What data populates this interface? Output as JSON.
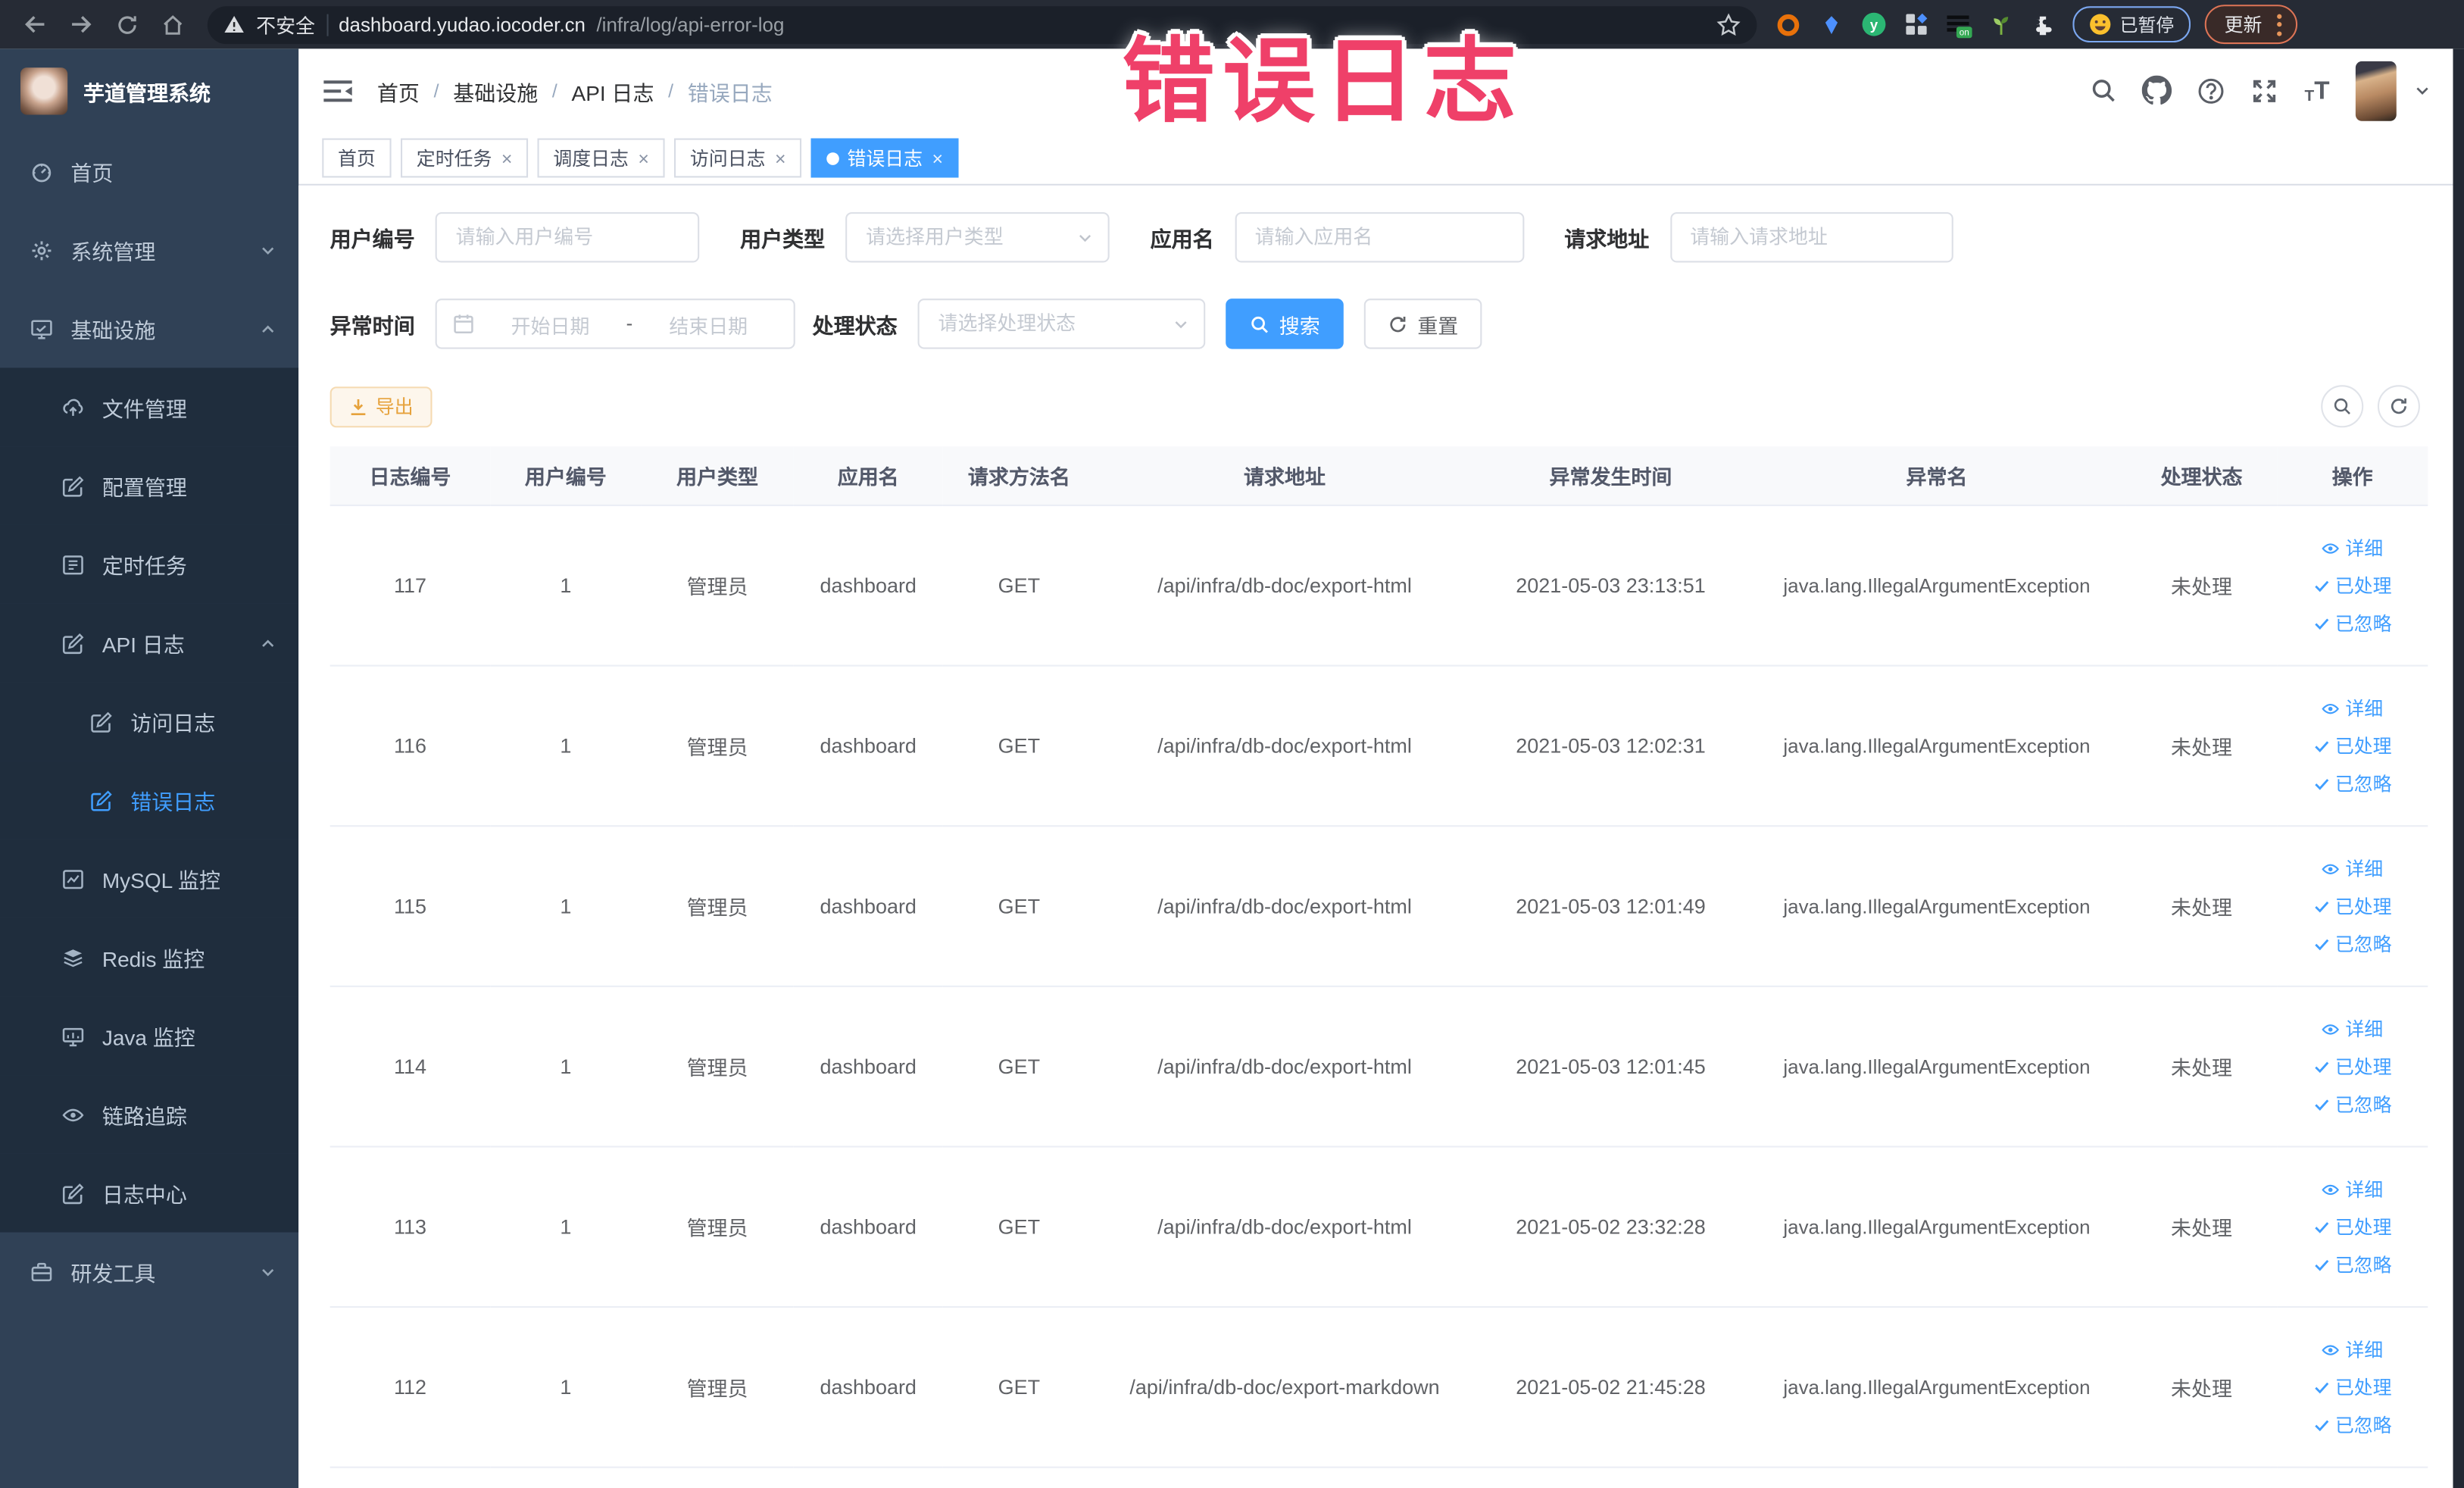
{
  "colors": {
    "primary": "#409eff",
    "warning": "#e6a23c",
    "overlay_pink": "#ef4069",
    "sidebar_bg": "#304156",
    "sidebar_submenu_bg": "#1f2d3d",
    "chrome_bg": "#262b35"
  },
  "overlay": {
    "title": "错误日志"
  },
  "browser": {
    "security_label": "不安全",
    "url_host": "dashboard.yudao.iocoder.cn",
    "url_path": "/infra/log/api-error-log",
    "paused_badge": "已暂停",
    "update_button": "更新",
    "extension_on_badge": "on",
    "extension_y_label": "y"
  },
  "sidebar": {
    "logo_title": "芋道管理系统",
    "items": [
      {
        "key": "home",
        "label": "首页",
        "icon": "dashboard-icon",
        "level": 1
      },
      {
        "key": "system-mgmt",
        "label": "系统管理",
        "icon": "gear-icon",
        "level": 1,
        "chevron": "down"
      },
      {
        "key": "infrastructure",
        "label": "基础设施",
        "icon": "monitor-check-icon",
        "level": 1,
        "chevron": "up"
      },
      {
        "key": "file-mgmt",
        "label": "文件管理",
        "icon": "upload-cloud-icon",
        "level": 2,
        "sub": true
      },
      {
        "key": "config-mgmt",
        "label": "配置管理",
        "icon": "edit-icon",
        "level": 2,
        "sub": true
      },
      {
        "key": "scheduled-jobs",
        "label": "定时任务",
        "icon": "schedule-icon",
        "level": 2,
        "sub": true
      },
      {
        "key": "api-log",
        "label": "API 日志",
        "icon": "log-icon",
        "level": 2,
        "sub": true,
        "chevron": "up"
      },
      {
        "key": "access-log",
        "label": "访问日志",
        "icon": "log-icon",
        "level": 3,
        "sub": true
      },
      {
        "key": "error-log",
        "label": "错误日志",
        "icon": "log-icon",
        "level": 3,
        "sub": true,
        "active": true
      },
      {
        "key": "mysql-monitor",
        "label": "MySQL 监控",
        "icon": "chart-icon",
        "level": 2,
        "sub": true
      },
      {
        "key": "redis-monitor",
        "label": "Redis 监控",
        "icon": "layers-icon",
        "level": 2,
        "sub": true
      },
      {
        "key": "java-monitor",
        "label": "Java 监控",
        "icon": "java-monitor-icon",
        "level": 2,
        "sub": true
      },
      {
        "key": "trace",
        "label": "链路追踪",
        "icon": "eye-icon",
        "level": 2,
        "sub": true
      },
      {
        "key": "log-center",
        "label": "日志中心",
        "icon": "log-center-icon",
        "level": 2,
        "sub": true
      },
      {
        "key": "dev-tools",
        "label": "研发工具",
        "icon": "toolbox-icon",
        "level": 1,
        "chevron": "down"
      }
    ]
  },
  "breadcrumb": [
    "首页",
    "基础设施",
    "API 日志",
    "错误日志"
  ],
  "tabs": [
    {
      "key": "home",
      "label": "首页",
      "closable": false,
      "active": false
    },
    {
      "key": "jobs",
      "label": "定时任务",
      "closable": true,
      "active": false
    },
    {
      "key": "job-log",
      "label": "调度日志",
      "closable": true,
      "active": false
    },
    {
      "key": "access-log",
      "label": "访问日志",
      "closable": true,
      "active": false
    },
    {
      "key": "error-log",
      "label": "错误日志",
      "closable": true,
      "active": true
    }
  ],
  "filters": {
    "user_id_label": "用户编号",
    "user_id_placeholder": "请输入用户编号",
    "user_type_label": "用户类型",
    "user_type_placeholder": "请选择用户类型",
    "app_name_label": "应用名",
    "app_name_placeholder": "请输入应用名",
    "request_url_label": "请求地址",
    "request_url_placeholder": "请输入请求地址",
    "exception_time_label": "异常时间",
    "start_date_placeholder": "开始日期",
    "range_separator": "-",
    "end_date_placeholder": "结束日期",
    "process_status_label": "处理状态",
    "process_status_placeholder": "请选择处理状态",
    "search_button": "搜索",
    "reset_button": "重置"
  },
  "toolbar": {
    "export_button": "导出"
  },
  "table": {
    "columns": [
      "日志编号",
      "用户编号",
      "用户类型",
      "应用名",
      "请求方法名",
      "请求地址",
      "异常发生时间",
      "异常名",
      "处理状态",
      "操作"
    ],
    "actions": [
      "详细",
      "已处理",
      "已忽略"
    ],
    "rows": [
      {
        "id": "117",
        "user_id": "1",
        "user_type": "管理员",
        "app": "dashboard",
        "method": "GET",
        "url": "/api/infra/db-doc/export-html",
        "time": "2021-05-03 23:13:51",
        "exception": "java.lang.IllegalArgumentException",
        "status": "未处理"
      },
      {
        "id": "116",
        "user_id": "1",
        "user_type": "管理员",
        "app": "dashboard",
        "method": "GET",
        "url": "/api/infra/db-doc/export-html",
        "time": "2021-05-03 12:02:31",
        "exception": "java.lang.IllegalArgumentException",
        "status": "未处理"
      },
      {
        "id": "115",
        "user_id": "1",
        "user_type": "管理员",
        "app": "dashboard",
        "method": "GET",
        "url": "/api/infra/db-doc/export-html",
        "time": "2021-05-03 12:01:49",
        "exception": "java.lang.IllegalArgumentException",
        "status": "未处理"
      },
      {
        "id": "114",
        "user_id": "1",
        "user_type": "管理员",
        "app": "dashboard",
        "method": "GET",
        "url": "/api/infra/db-doc/export-html",
        "time": "2021-05-03 12:01:45",
        "exception": "java.lang.IllegalArgumentException",
        "status": "未处理"
      },
      {
        "id": "113",
        "user_id": "1",
        "user_type": "管理员",
        "app": "dashboard",
        "method": "GET",
        "url": "/api/infra/db-doc/export-html",
        "time": "2021-05-02 23:32:28",
        "exception": "java.lang.IllegalArgumentException",
        "status": "未处理"
      },
      {
        "id": "112",
        "user_id": "1",
        "user_type": "管理员",
        "app": "dashboard",
        "method": "GET",
        "url": "/api/infra/db-doc/export-markdown",
        "time": "2021-05-02 21:45:28",
        "exception": "java.lang.IllegalArgumentException",
        "status": "未处理"
      }
    ]
  }
}
